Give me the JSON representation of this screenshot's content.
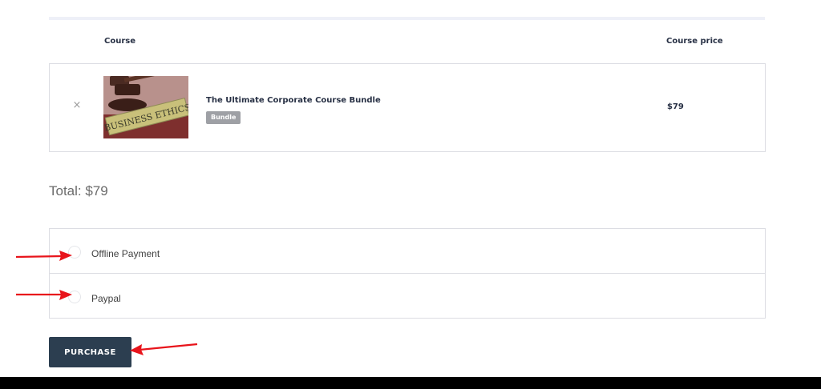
{
  "table": {
    "header_course": "Course",
    "header_price": "Course price"
  },
  "cart": {
    "remove_icon": "×",
    "thumbnail_sign_text": "BUSINESS ETHICS",
    "course_title": "The Ultimate Corporate Course Bundle",
    "badge": "Bundle",
    "price": "$79"
  },
  "total": "Total: $79",
  "payment": {
    "options": [
      {
        "label": "Offline Payment",
        "selected": false
      },
      {
        "label": "Paypal",
        "selected": false
      }
    ]
  },
  "purchase_label": "PURCHASE",
  "colors": {
    "button_bg": "#2c3e50",
    "annotation_arrow": "#e8141b",
    "badge_bg": "#9ea0a5"
  }
}
